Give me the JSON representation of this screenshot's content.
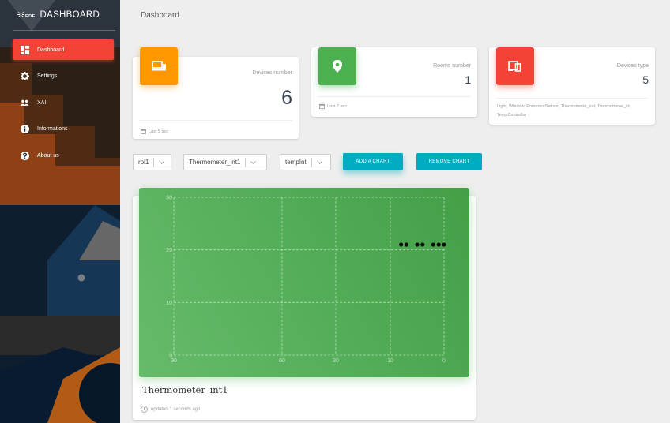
{
  "app": {
    "brand_logo": "EDF",
    "brand_name": "DASHBOARD",
    "page_title": "Dashboard"
  },
  "sidebar": {
    "items": [
      {
        "label": "Dashboard",
        "icon": "dashboard-icon",
        "active": true
      },
      {
        "label": "Settings",
        "icon": "gear-icon",
        "active": false
      },
      {
        "label": "XAI",
        "icon": "people-icon",
        "active": false
      },
      {
        "label": "Informations",
        "icon": "info-icon",
        "active": false
      },
      {
        "label": "About us",
        "icon": "help-icon",
        "active": false
      }
    ]
  },
  "stats": [
    {
      "label": "Devices number",
      "value": "6",
      "footer": "Last 5 sec",
      "color": "#ff9800",
      "icon": "laptop-icon"
    },
    {
      "label": "Rooms number",
      "value": "1",
      "footer": "Last 2 sec",
      "color": "#4caf50",
      "icon": "location-pin-icon"
    },
    {
      "label": "Devices type",
      "value": "5",
      "footer": "Light, Window, PresenceSensor, Thermometer_ext, Thermometer_int, TempController",
      "color": "#f44336",
      "icon": "devices-icon"
    }
  ],
  "controls": {
    "select_device": "rpi1",
    "select_sensor": "Thermometer_int1",
    "select_metric": "tempInt",
    "add_chart_label": "ADD A CHART",
    "remove_chart_label": "REMOVE CHART"
  },
  "chart_card": {
    "title": "Thermometer_int1",
    "updated": "updated 1 seconds ago"
  },
  "chart_data": {
    "type": "scatter",
    "ylim": [
      0,
      30
    ],
    "yticks": [
      "30",
      "20",
      "10",
      "0"
    ],
    "xticks": [
      "90",
      "60",
      "30",
      "10",
      "0"
    ],
    "grid": true,
    "points": [
      {
        "x": 8,
        "y": 21
      },
      {
        "x": 7,
        "y": 21
      },
      {
        "x": 5,
        "y": 21
      },
      {
        "x": 4,
        "y": 21
      },
      {
        "x": 2,
        "y": 21
      },
      {
        "x": 1,
        "y": 21
      },
      {
        "x": 0,
        "y": 21
      }
    ]
  },
  "colors": {
    "accent_red": "#f44336",
    "accent_cyan": "#00acc1",
    "chart_green": "#4caf50"
  }
}
